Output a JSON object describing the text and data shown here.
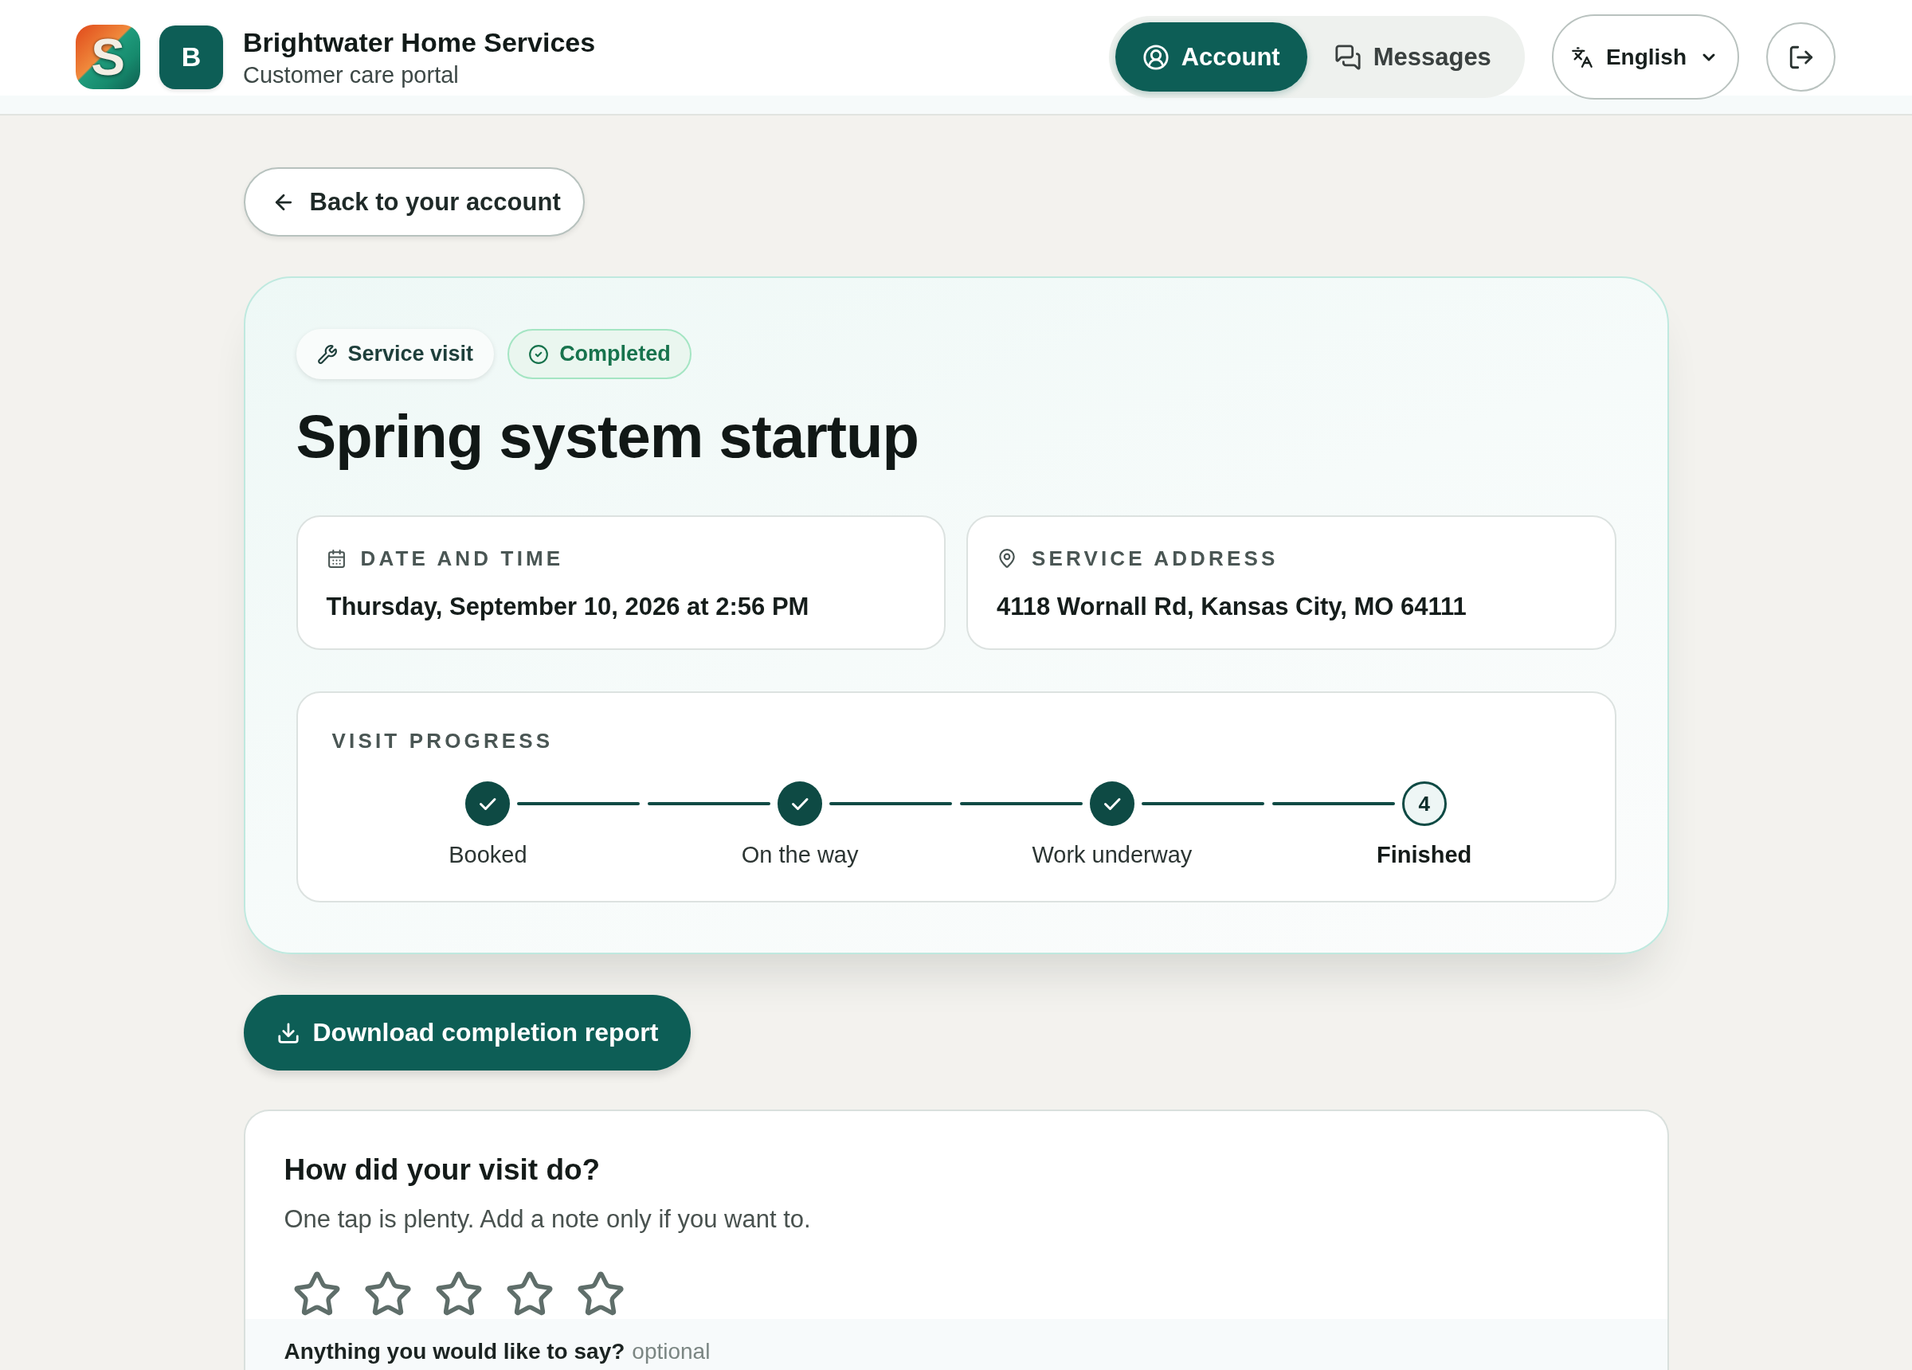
{
  "header": {
    "logo_letter": "S",
    "company_initial": "B",
    "company_name": "Brightwater Home Services",
    "portal_name": "Customer care portal",
    "nav": [
      {
        "kind": "account",
        "label": "Account",
        "selected": true
      },
      {
        "kind": "messages",
        "label": "Messages",
        "selected": false
      }
    ],
    "language": {
      "label": "English"
    }
  },
  "back_link": {
    "label": "Back to your account"
  },
  "visit": {
    "tags": [
      {
        "kind": "category",
        "label": "Service visit"
      },
      {
        "kind": "status",
        "label": "Completed"
      }
    ],
    "title": "Spring system startup",
    "details": [
      {
        "kind": "date",
        "label": "DATE AND TIME",
        "value": "Thursday, September 10, 2026 at 2:56 PM"
      },
      {
        "kind": "address",
        "label": "SERVICE ADDRESS",
        "value": "4118 Wornall Rd, Kansas City, MO 64111"
      }
    ],
    "progress": {
      "title": "VISIT PROGRESS",
      "steps": [
        {
          "label": "Booked",
          "done": true,
          "current": false
        },
        {
          "label": "On the way",
          "done": true,
          "current": false
        },
        {
          "label": "Work underway",
          "done": true,
          "current": false
        },
        {
          "label": "Finished",
          "number": "4",
          "done": false,
          "current": true
        }
      ]
    }
  },
  "download_button": {
    "label": "Download completion report"
  },
  "feedback": {
    "title": "How did your visit do?",
    "subtitle": "One tap is plenty. Add a note only if you want to.",
    "rating": {
      "stars": 0
    },
    "note": {
      "label": "Anything you would like to say?",
      "hint": "optional"
    }
  }
}
